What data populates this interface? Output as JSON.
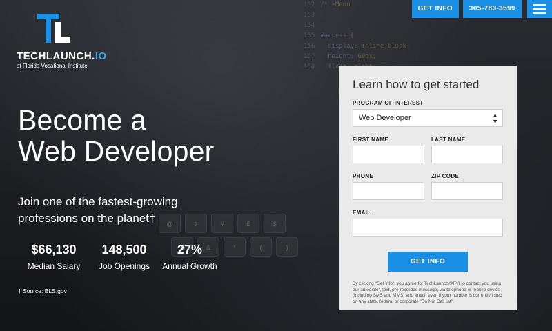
{
  "brand": {
    "name_main": "TECHLAUNCH.",
    "name_accent": "IO",
    "subtitle": "at Florida Vocational Institute",
    "accent_color": "#1a8fe6"
  },
  "nav": {
    "info_button": "GET INFO",
    "phone_button": "305-783-3599",
    "menu_icon": "hamburger-icon"
  },
  "hero": {
    "headline_line1": "Become a",
    "headline_line2": "Web Developer",
    "subhead": "Join one of the fastest-growing professions on the planet†",
    "stats": [
      {
        "value": "$66,130",
        "label": "Median Salary"
      },
      {
        "value": "148,500",
        "label": "Job Openings"
      },
      {
        "value": "27%",
        "label": "Annual Growth"
      }
    ],
    "source": "† Source: BLS.gov"
  },
  "background_code": [
    {
      "num": "152",
      "text": "/* ",
      "kw": "",
      "val": "~Menu"
    },
    {
      "num": "153",
      "text": "",
      "kw": "",
      "val": ""
    },
    {
      "num": "154",
      "text": "",
      "kw": "",
      "val": ""
    },
    {
      "num": "155",
      "text": "",
      "kw": "#access",
      "val": " {"
    },
    {
      "num": "156",
      "text": "  ",
      "kw": "display:",
      "val": " inline-block;"
    },
    {
      "num": "157",
      "text": "  ",
      "kw": "height:",
      "val": " 69px;"
    },
    {
      "num": "158",
      "text": "  ",
      "kw": "float:",
      "val": " right;"
    }
  ],
  "keyboard_keys": [
    "@",
    "€",
    "#",
    "£",
    "$",
    "%",
    "&",
    "*",
    "(",
    ")"
  ],
  "form": {
    "title": "Learn how to get started",
    "program_label": "PROGRAM OF INTEREST",
    "program_value": "Web Developer",
    "first_name_label": "FIRST NAME",
    "last_name_label": "LAST NAME",
    "phone_label": "PHONE",
    "zip_label": "ZIP CODE",
    "email_label": "EMAIL",
    "submit_label": "GET INFO",
    "disclaimer": "By clicking \"Get Info\", you agree for TechLaunch@FVI to contact you using our autodialer, text, pre-recorded message, via telephone or mobile device (including SMS and MMS) and email, even if your number is currently listed on any state, federal or corporate \"Do Not Call list\"."
  }
}
